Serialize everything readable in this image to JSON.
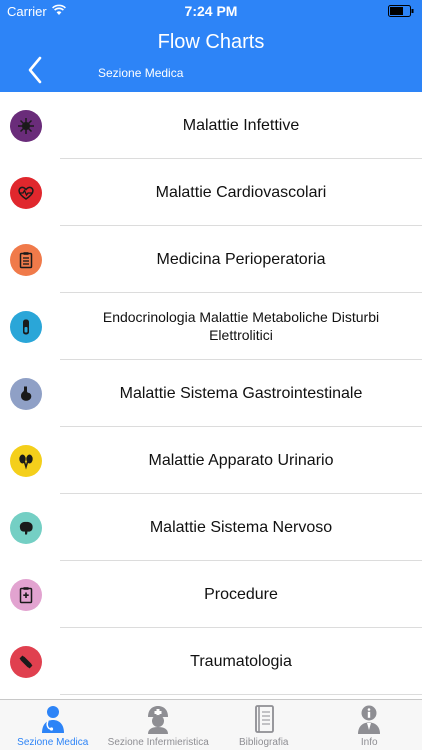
{
  "status": {
    "carrier": "Carrier",
    "time": "7:24 PM"
  },
  "nav": {
    "title": "Flow Charts",
    "subtitle": "Sezione Medica"
  },
  "items": [
    {
      "label": "Malattie Infettive",
      "icon": "virus-icon",
      "color": "#6a2c7a"
    },
    {
      "label": "Malattie Cardiovascolari",
      "icon": "heart-icon",
      "color": "#e0272d"
    },
    {
      "label": "Medicina Perioperatoria",
      "icon": "clipboard-icon",
      "color": "#f07a4a"
    },
    {
      "label": "Endocrinologia Malattie Metaboliche Disturbi Elettrolitici",
      "icon": "test-tube-icon",
      "color": "#2aa6d8"
    },
    {
      "label": "Malattie Sistema Gastrointestinale",
      "icon": "stomach-icon",
      "color": "#8fa0c6"
    },
    {
      "label": "Malattie Apparato Urinario",
      "icon": "kidney-icon",
      "color": "#f4cf1b"
    },
    {
      "label": "Malattie Sistema Nervoso",
      "icon": "brain-icon",
      "color": "#74cfc4"
    },
    {
      "label": "Procedure",
      "icon": "checklist-icon",
      "color": "#e2a3d0"
    },
    {
      "label": "Traumatologia",
      "icon": "bandage-icon",
      "color": "#e0404f"
    }
  ],
  "tabs": [
    {
      "label": "Sezione Medica",
      "icon": "doctor-icon",
      "active": true
    },
    {
      "label": "Sezione Infermieristica",
      "icon": "nurse-icon",
      "active": false
    },
    {
      "label": "Bibliografia",
      "icon": "book-icon",
      "active": false
    },
    {
      "label": "Info",
      "icon": "info-person-icon",
      "active": false
    }
  ],
  "colors": {
    "accent": "#2d84f7",
    "tab_inactive": "#8e8e93"
  }
}
